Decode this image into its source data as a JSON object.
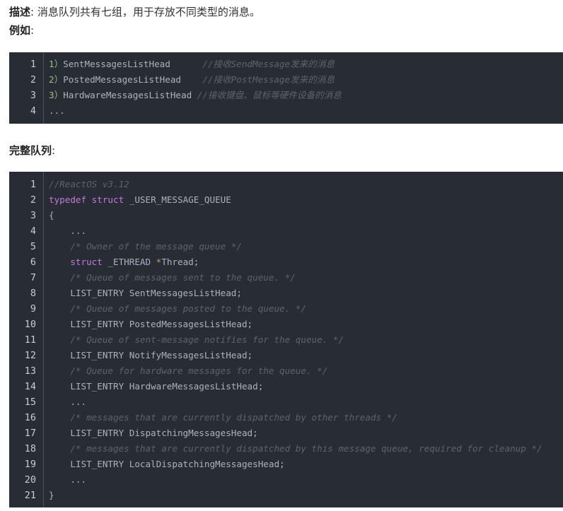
{
  "description": {
    "label": "描述",
    "colon": ":",
    "text": "消息队列共有七组，用于存放不同类型的消息。"
  },
  "example": {
    "label": "例如",
    "colon": ":"
  },
  "code_block_1": {
    "lines": [
      {
        "num": "1",
        "tokens": [
          {
            "t": "1）",
            "c": "nm"
          },
          {
            "t": "SentMessagesListHead      ",
            "c": "txt"
          },
          {
            "t": "//接收SendMessage发来的消息",
            "c": "cm"
          }
        ]
      },
      {
        "num": "2",
        "tokens": [
          {
            "t": "2）",
            "c": "nm"
          },
          {
            "t": "PostedMessagesListHead    ",
            "c": "txt"
          },
          {
            "t": "//接收PostMessage发来的消息",
            "c": "cm"
          }
        ]
      },
      {
        "num": "3",
        "tokens": [
          {
            "t": "3）",
            "c": "nm"
          },
          {
            "t": "HardwareMessagesListHead ",
            "c": "txt"
          },
          {
            "t": "//接收键盘、鼠标等硬件设备的消息",
            "c": "cm"
          }
        ]
      },
      {
        "num": "4",
        "tokens": [
          {
            "t": "...",
            "c": "txt"
          }
        ]
      }
    ]
  },
  "full_queue": {
    "label": "完整队列",
    "colon": ":"
  },
  "code_block_2": {
    "lines": [
      {
        "num": "1",
        "tokens": [
          {
            "t": "//ReactOS v3.12",
            "c": "cm"
          }
        ]
      },
      {
        "num": "2",
        "tokens": [
          {
            "t": "typedef",
            "c": "kw"
          },
          {
            "t": " ",
            "c": "txt"
          },
          {
            "t": "struct",
            "c": "kw"
          },
          {
            "t": " _USER_MESSAGE_QUEUE",
            "c": "txt"
          }
        ]
      },
      {
        "num": "3",
        "tokens": [
          {
            "t": "{",
            "c": "txt"
          }
        ]
      },
      {
        "num": "4",
        "tokens": [
          {
            "t": "    ...",
            "c": "txt"
          }
        ]
      },
      {
        "num": "5",
        "tokens": [
          {
            "t": "    ",
            "c": "txt"
          },
          {
            "t": "/* Owner of the message queue */",
            "c": "cm"
          }
        ]
      },
      {
        "num": "6",
        "tokens": [
          {
            "t": "    ",
            "c": "txt"
          },
          {
            "t": "struct",
            "c": "kw"
          },
          {
            "t": " _ETHREAD ",
            "c": "txt"
          },
          {
            "t": "*",
            "c": "ast"
          },
          {
            "t": "Thread;",
            "c": "txt"
          }
        ]
      },
      {
        "num": "7",
        "tokens": [
          {
            "t": "    ",
            "c": "txt"
          },
          {
            "t": "/* Queue of messages sent to the queue. */",
            "c": "cm"
          }
        ]
      },
      {
        "num": "8",
        "tokens": [
          {
            "t": "    LIST_ENTRY SentMessagesListHead;",
            "c": "txt"
          }
        ]
      },
      {
        "num": "9",
        "tokens": [
          {
            "t": "    ",
            "c": "txt"
          },
          {
            "t": "/* Queue of messages posted to the queue. */",
            "c": "cm"
          }
        ]
      },
      {
        "num": "10",
        "tokens": [
          {
            "t": "    LIST_ENTRY PostedMessagesListHead;",
            "c": "txt"
          }
        ]
      },
      {
        "num": "11",
        "tokens": [
          {
            "t": "    ",
            "c": "txt"
          },
          {
            "t": "/* Queue of sent-message notifies for the queue. */",
            "c": "cm"
          }
        ]
      },
      {
        "num": "12",
        "tokens": [
          {
            "t": "    LIST_ENTRY NotifyMessagesListHead;",
            "c": "txt"
          }
        ]
      },
      {
        "num": "13",
        "tokens": [
          {
            "t": "    ",
            "c": "txt"
          },
          {
            "t": "/* Queue for hardware messages for the queue. */",
            "c": "cm"
          }
        ]
      },
      {
        "num": "14",
        "tokens": [
          {
            "t": "    LIST_ENTRY HardwareMessagesListHead;",
            "c": "txt"
          }
        ]
      },
      {
        "num": "15",
        "tokens": [
          {
            "t": "    ...",
            "c": "txt"
          }
        ]
      },
      {
        "num": "16",
        "tokens": [
          {
            "t": "    ",
            "c": "txt"
          },
          {
            "t": "/* messages that are currently dispatched by other threads */",
            "c": "cm"
          }
        ]
      },
      {
        "num": "17",
        "tokens": [
          {
            "t": "    LIST_ENTRY DispatchingMessagesHead;",
            "c": "txt"
          }
        ]
      },
      {
        "num": "18",
        "tokens": [
          {
            "t": "    ",
            "c": "txt"
          },
          {
            "t": "/* messages that are currently dispatched by this message queue, required for cleanup */",
            "c": "cm"
          }
        ]
      },
      {
        "num": "19",
        "tokens": [
          {
            "t": "    LIST_ENTRY LocalDispatchingMessagesHead;",
            "c": "txt"
          }
        ]
      },
      {
        "num": "20",
        "tokens": [
          {
            "t": "    ...",
            "c": "txt"
          }
        ]
      },
      {
        "num": "21",
        "tokens": [
          {
            "t": "}",
            "c": "txt"
          }
        ]
      }
    ]
  },
  "colors": {
    "code_background": "#282c34",
    "comment": "#5c6370",
    "keyword": "#c678dd",
    "list_number": "#98c379",
    "pointer": "#d19a66",
    "plain_code": "#abb2bf"
  }
}
